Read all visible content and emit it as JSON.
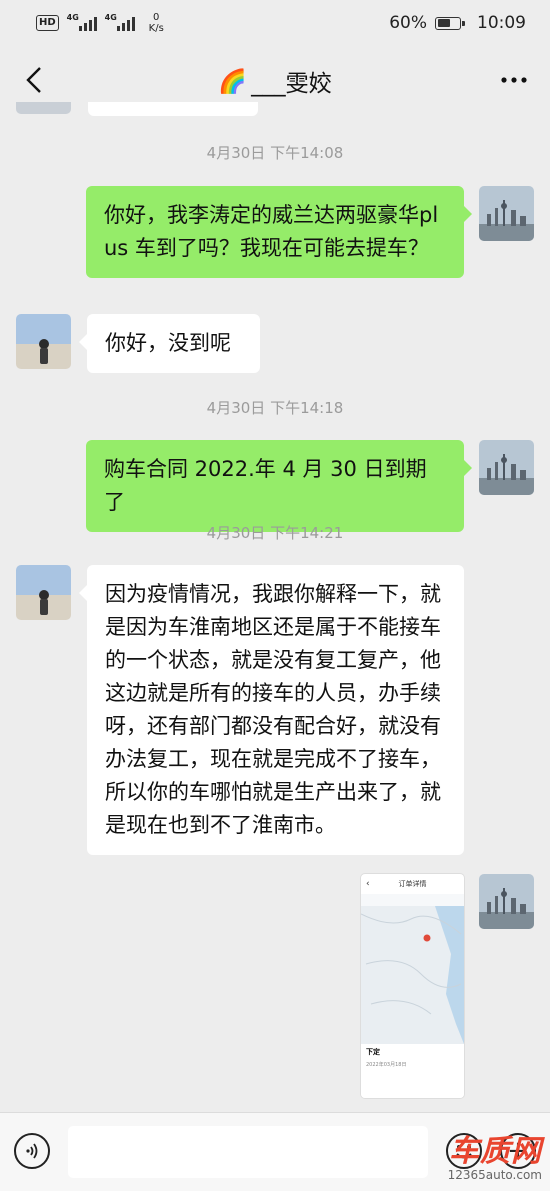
{
  "status_bar": {
    "network_badge": "HD",
    "sim1_label": "4G",
    "sim2_label": "4G",
    "speed_value": "0",
    "speed_unit": "K/s",
    "battery": "60%",
    "battery_level": 0.6,
    "time": "10:09"
  },
  "header": {
    "title_emoji": "🌈",
    "title": "___雯姣"
  },
  "messages": [
    {
      "type": "time",
      "text": "4月30日 下午14:08"
    },
    {
      "type": "out",
      "text": "你好，我李涛定的威兰达两驱豪华plus 车到了吗？我现在可能去提车？"
    },
    {
      "type": "in",
      "text": "你好，没到呢"
    },
    {
      "type": "time",
      "text": "4月30日 下午14:18"
    },
    {
      "type": "out",
      "text": "购车合同 2022.年 4 月 30 日到期了"
    },
    {
      "type": "time",
      "text": "4月30日 下午14:21"
    },
    {
      "type": "in",
      "text": "因为疫情情况，我跟你解释一下，就是因为车淮南地区还是属于不能接车的一个状态，就是没有复工复产，他这边就是所有的接车的人员，办手续呀，还有部门都没有配合好，就没有办法复工，现在就是完成不了接车，所以你的车哪怕就是生产出来了，就是现在也到不了淮南市。"
    },
    {
      "type": "image_out",
      "screenshot_title": "订单详情",
      "screenshot_status": "下定",
      "screenshot_date": "2022年03月18日"
    }
  ],
  "input": {
    "placeholder": ""
  },
  "watermark": {
    "logo": "车质网",
    "url": "12365auto.com"
  },
  "colors": {
    "outgoing_bubble": "#95ec69",
    "incoming_bubble": "#ffffff",
    "background": "#ededed"
  }
}
